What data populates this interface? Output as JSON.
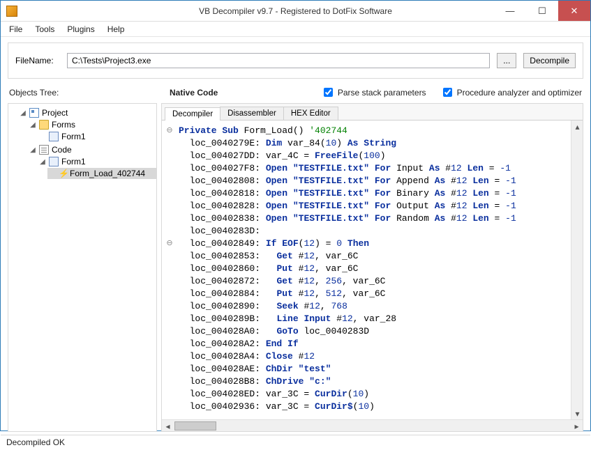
{
  "window": {
    "title": "VB Decompiler v9.7 - Registered to DotFix Software"
  },
  "menu": {
    "file": "File",
    "tools": "Tools",
    "plugins": "Plugins",
    "help": "Help"
  },
  "filebar": {
    "label": "FileName:",
    "path": "C:\\Tests\\Project3.exe",
    "browse": "...",
    "decompile": "Decompile"
  },
  "options": {
    "objects_tree": "Objects Tree:",
    "native_code": "Native Code",
    "parse_stack": "Parse stack parameters",
    "proc_analyzer": "Procedure analyzer and optimizer"
  },
  "tree": {
    "project": "Project",
    "forms": "Forms",
    "form1a": "Form1",
    "code": "Code",
    "form1b": "Form1",
    "formload": "Form_Load_402744"
  },
  "tabs": {
    "decompiler": "Decompiler",
    "disassembler": "Disassembler",
    "hexeditor": "HEX Editor"
  },
  "code_lines": [
    {
      "gutter": "⊖",
      "tokens": [
        {
          "t": "kw",
          "v": "Private Sub"
        },
        {
          "t": "ident",
          "v": " Form_Load() "
        },
        {
          "t": "cmt",
          "v": "'402744"
        }
      ]
    },
    {
      "tokens": [
        {
          "t": "ident",
          "v": "  loc_0040279E: "
        },
        {
          "t": "kw",
          "v": "Dim"
        },
        {
          "t": "ident",
          "v": " var_84("
        },
        {
          "t": "num",
          "v": "10"
        },
        {
          "t": "ident",
          "v": ") "
        },
        {
          "t": "kw",
          "v": "As String"
        }
      ]
    },
    {
      "tokens": [
        {
          "t": "ident",
          "v": "  loc_004027DD: var_4C = "
        },
        {
          "t": "kw",
          "v": "FreeFile"
        },
        {
          "t": "ident",
          "v": "("
        },
        {
          "t": "num",
          "v": "100"
        },
        {
          "t": "ident",
          "v": ")"
        }
      ]
    },
    {
      "tokens": [
        {
          "t": "ident",
          "v": "  loc_004027F8: "
        },
        {
          "t": "kw",
          "v": "Open "
        },
        {
          "t": "str",
          "v": "\"TESTFILE.txt\""
        },
        {
          "t": "kw",
          "v": " For"
        },
        {
          "t": "ident",
          "v": " Input "
        },
        {
          "t": "kw",
          "v": "As"
        },
        {
          "t": "ident",
          "v": " #"
        },
        {
          "t": "num",
          "v": "12"
        },
        {
          "t": "kw",
          "v": " Len"
        },
        {
          "t": "ident",
          "v": " = "
        },
        {
          "t": "num",
          "v": "-1"
        }
      ]
    },
    {
      "tokens": [
        {
          "t": "ident",
          "v": "  loc_00402808: "
        },
        {
          "t": "kw",
          "v": "Open "
        },
        {
          "t": "str",
          "v": "\"TESTFILE.txt\""
        },
        {
          "t": "kw",
          "v": " For"
        },
        {
          "t": "ident",
          "v": " Append "
        },
        {
          "t": "kw",
          "v": "As"
        },
        {
          "t": "ident",
          "v": " #"
        },
        {
          "t": "num",
          "v": "12"
        },
        {
          "t": "kw",
          "v": " Len"
        },
        {
          "t": "ident",
          "v": " = "
        },
        {
          "t": "num",
          "v": "-1"
        }
      ]
    },
    {
      "tokens": [
        {
          "t": "ident",
          "v": "  loc_00402818: "
        },
        {
          "t": "kw",
          "v": "Open "
        },
        {
          "t": "str",
          "v": "\"TESTFILE.txt\""
        },
        {
          "t": "kw",
          "v": " For"
        },
        {
          "t": "ident",
          "v": " Binary "
        },
        {
          "t": "kw",
          "v": "As"
        },
        {
          "t": "ident",
          "v": " #"
        },
        {
          "t": "num",
          "v": "12"
        },
        {
          "t": "kw",
          "v": " Len"
        },
        {
          "t": "ident",
          "v": " = "
        },
        {
          "t": "num",
          "v": "-1"
        }
      ]
    },
    {
      "tokens": [
        {
          "t": "ident",
          "v": "  loc_00402828: "
        },
        {
          "t": "kw",
          "v": "Open "
        },
        {
          "t": "str",
          "v": "\"TESTFILE.txt\""
        },
        {
          "t": "kw",
          "v": " For"
        },
        {
          "t": "ident",
          "v": " Output "
        },
        {
          "t": "kw",
          "v": "As"
        },
        {
          "t": "ident",
          "v": " #"
        },
        {
          "t": "num",
          "v": "12"
        },
        {
          "t": "kw",
          "v": " Len"
        },
        {
          "t": "ident",
          "v": " = "
        },
        {
          "t": "num",
          "v": "-1"
        }
      ]
    },
    {
      "tokens": [
        {
          "t": "ident",
          "v": "  loc_00402838: "
        },
        {
          "t": "kw",
          "v": "Open "
        },
        {
          "t": "str",
          "v": "\"TESTFILE.txt\""
        },
        {
          "t": "kw",
          "v": " For"
        },
        {
          "t": "ident",
          "v": " Random "
        },
        {
          "t": "kw",
          "v": "As"
        },
        {
          "t": "ident",
          "v": " #"
        },
        {
          "t": "num",
          "v": "12"
        },
        {
          "t": "kw",
          "v": " Len"
        },
        {
          "t": "ident",
          "v": " = "
        },
        {
          "t": "num",
          "v": "-1"
        }
      ]
    },
    {
      "tokens": [
        {
          "t": "ident",
          "v": "  loc_0040283D:"
        }
      ]
    },
    {
      "gutter": "⊖",
      "tokens": [
        {
          "t": "ident",
          "v": "  loc_00402849: "
        },
        {
          "t": "kw",
          "v": "If EOF"
        },
        {
          "t": "ident",
          "v": "("
        },
        {
          "t": "num",
          "v": "12"
        },
        {
          "t": "ident",
          "v": ") = "
        },
        {
          "t": "num",
          "v": "0"
        },
        {
          "t": "kw",
          "v": " Then"
        }
      ]
    },
    {
      "tokens": [
        {
          "t": "ident",
          "v": "  loc_00402853:   "
        },
        {
          "t": "kw",
          "v": "Get"
        },
        {
          "t": "ident",
          "v": " #"
        },
        {
          "t": "num",
          "v": "12"
        },
        {
          "t": "ident",
          "v": ", var_6C"
        }
      ]
    },
    {
      "tokens": [
        {
          "t": "ident",
          "v": "  loc_00402860:   "
        },
        {
          "t": "kw",
          "v": "Put"
        },
        {
          "t": "ident",
          "v": " #"
        },
        {
          "t": "num",
          "v": "12"
        },
        {
          "t": "ident",
          "v": ", var_6C"
        }
      ]
    },
    {
      "tokens": [
        {
          "t": "ident",
          "v": "  loc_00402872:   "
        },
        {
          "t": "kw",
          "v": "Get"
        },
        {
          "t": "ident",
          "v": " #"
        },
        {
          "t": "num",
          "v": "12"
        },
        {
          "t": "ident",
          "v": ", "
        },
        {
          "t": "num",
          "v": "256"
        },
        {
          "t": "ident",
          "v": ", var_6C"
        }
      ]
    },
    {
      "tokens": [
        {
          "t": "ident",
          "v": "  loc_00402884:   "
        },
        {
          "t": "kw",
          "v": "Put"
        },
        {
          "t": "ident",
          "v": " #"
        },
        {
          "t": "num",
          "v": "12"
        },
        {
          "t": "ident",
          "v": ", "
        },
        {
          "t": "num",
          "v": "512"
        },
        {
          "t": "ident",
          "v": ", var_6C"
        }
      ]
    },
    {
      "tokens": [
        {
          "t": "ident",
          "v": "  loc_00402890:   "
        },
        {
          "t": "kw",
          "v": "Seek"
        },
        {
          "t": "ident",
          "v": " #"
        },
        {
          "t": "num",
          "v": "12"
        },
        {
          "t": "ident",
          "v": ", "
        },
        {
          "t": "num",
          "v": "768"
        }
      ]
    },
    {
      "tokens": [
        {
          "t": "ident",
          "v": "  loc_0040289B:   "
        },
        {
          "t": "kw",
          "v": "Line Input"
        },
        {
          "t": "ident",
          "v": " #"
        },
        {
          "t": "num",
          "v": "12"
        },
        {
          "t": "ident",
          "v": ", var_28"
        }
      ]
    },
    {
      "tokens": [
        {
          "t": "ident",
          "v": "  loc_004028A0:   "
        },
        {
          "t": "kw",
          "v": "GoTo"
        },
        {
          "t": "ident",
          "v": " loc_0040283D"
        }
      ]
    },
    {
      "tokens": [
        {
          "t": "ident",
          "v": "  loc_004028A2: "
        },
        {
          "t": "kw",
          "v": "End If"
        }
      ]
    },
    {
      "tokens": [
        {
          "t": "ident",
          "v": "  loc_004028A4: "
        },
        {
          "t": "kw",
          "v": "Close"
        },
        {
          "t": "ident",
          "v": " #"
        },
        {
          "t": "num",
          "v": "12"
        }
      ]
    },
    {
      "tokens": [
        {
          "t": "ident",
          "v": "  loc_004028AE: "
        },
        {
          "t": "kw",
          "v": "ChDir "
        },
        {
          "t": "str",
          "v": "\"test\""
        }
      ]
    },
    {
      "tokens": [
        {
          "t": "ident",
          "v": "  loc_004028B8: "
        },
        {
          "t": "kw",
          "v": "ChDrive "
        },
        {
          "t": "str",
          "v": "\"c:\""
        }
      ]
    },
    {
      "tokens": [
        {
          "t": "ident",
          "v": "  loc_004028ED: var_3C = "
        },
        {
          "t": "kw",
          "v": "CurDir"
        },
        {
          "t": "ident",
          "v": "("
        },
        {
          "t": "num",
          "v": "10"
        },
        {
          "t": "ident",
          "v": ")"
        }
      ]
    },
    {
      "tokens": [
        {
          "t": "ident",
          "v": "  loc_00402936: var_3C = "
        },
        {
          "t": "kw",
          "v": "CurDir$"
        },
        {
          "t": "ident",
          "v": "("
        },
        {
          "t": "num",
          "v": "10"
        },
        {
          "t": "ident",
          "v": ")"
        }
      ]
    }
  ],
  "status": "Decompiled OK"
}
